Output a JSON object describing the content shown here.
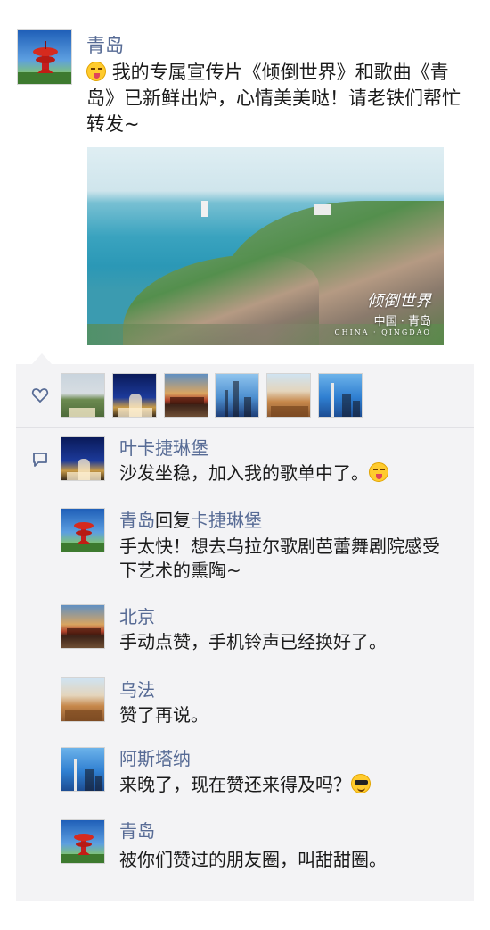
{
  "post": {
    "author": "青岛",
    "text": "我的专属宣传片《倾倒世界》和歌曲《青岛》已新鲜出炉，心情美美哒！请老铁们帮忙转发~",
    "photo_watermark": {
      "main": "倾倒世界",
      "sub": "中国 · 青岛",
      "en": "CHINA · QINGDAO"
    }
  },
  "likes": {
    "icon": "heart-icon",
    "count_avatars": 6
  },
  "comments": [
    {
      "author": "叶卡捷琳堡",
      "text": "沙发坐稳，加入我的歌单中了。",
      "emoji": "tongue-out-emoji"
    },
    {
      "author": "青岛",
      "reply_word": "回复",
      "reply_to": "卡捷琳堡",
      "text": "手太快！想去乌拉尔歌剧芭蕾舞剧院感受下艺术的熏陶~"
    },
    {
      "author": "北京",
      "text": "手动点赞，手机铃声已经换好了。"
    },
    {
      "author": "乌法",
      "text": "赞了再说。"
    },
    {
      "author": "阿斯塔纳",
      "text": "来晚了，现在赞还来得及吗？",
      "emoji": "sunglasses-emoji"
    },
    {
      "author": "青岛",
      "text": "被你们赞过的朋友圈，叫甜甜圈。"
    }
  ]
}
